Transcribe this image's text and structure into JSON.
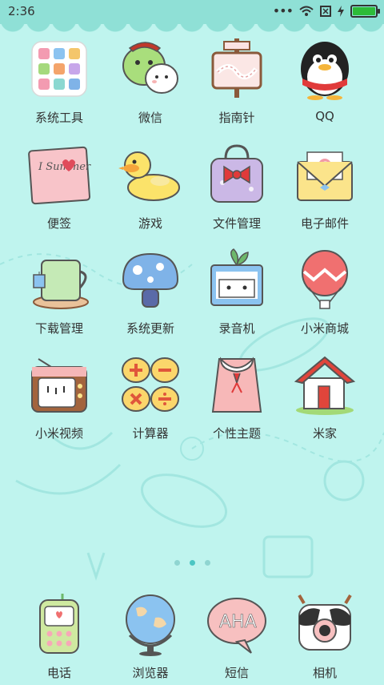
{
  "status": {
    "time": "2:36",
    "icons": [
      "more-icon",
      "wifi-icon",
      "sim-icon",
      "charging-icon",
      "battery-icon"
    ],
    "battery_level": 1.0
  },
  "apps": [
    {
      "label": "系统工具",
      "icon": "system-tools-icon"
    },
    {
      "label": "微信",
      "icon": "wechat-icon"
    },
    {
      "label": "指南针",
      "icon": "compass-icon"
    },
    {
      "label": "QQ",
      "icon": "qq-icon"
    },
    {
      "label": "便签",
      "icon": "notes-icon"
    },
    {
      "label": "游戏",
      "icon": "games-icon"
    },
    {
      "label": "文件管理",
      "icon": "file-manager-icon"
    },
    {
      "label": "电子邮件",
      "icon": "email-icon"
    },
    {
      "label": "下载管理",
      "icon": "downloads-icon"
    },
    {
      "label": "系统更新",
      "icon": "system-update-icon"
    },
    {
      "label": "录音机",
      "icon": "recorder-icon"
    },
    {
      "label": "小米商城",
      "icon": "mi-store-icon"
    },
    {
      "label": "小米视频",
      "icon": "mi-video-icon"
    },
    {
      "label": "计算器",
      "icon": "calculator-icon"
    },
    {
      "label": "个性主题",
      "icon": "themes-icon"
    },
    {
      "label": "米家",
      "icon": "mijia-icon"
    }
  ],
  "notes_text": "I Summer",
  "email_symbol": "@",
  "dock": [
    {
      "label": "电话",
      "icon": "phone-icon"
    },
    {
      "label": "浏览器",
      "icon": "browser-icon"
    },
    {
      "label": "短信",
      "icon": "messages-icon",
      "bubble_text": "AHA"
    },
    {
      "label": "相机",
      "icon": "camera-icon"
    }
  ],
  "pager": {
    "pages": 3,
    "current": 2
  },
  "colors": {
    "statusbar": "#8fe0d6",
    "background": "#bff4ee",
    "battery": "#2dbb38"
  }
}
